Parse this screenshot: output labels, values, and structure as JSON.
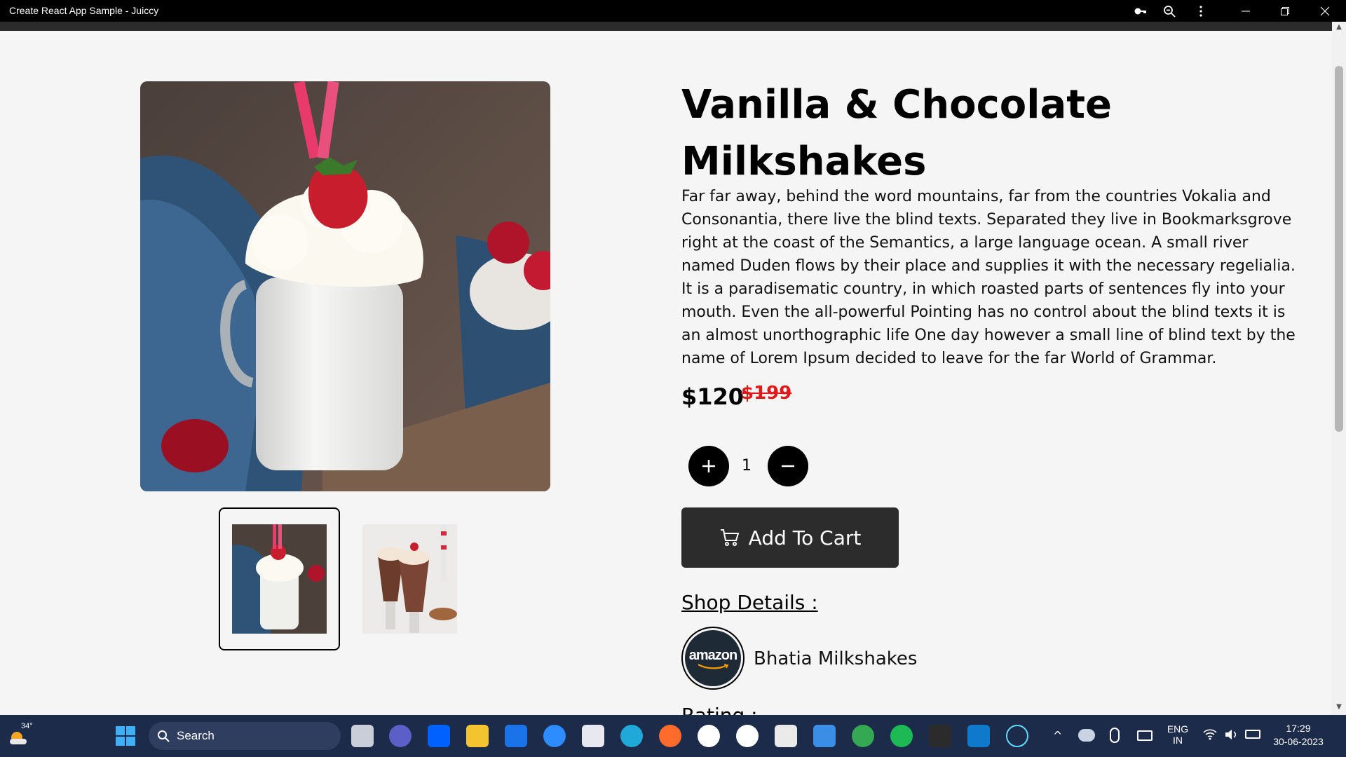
{
  "window": {
    "title": "Create React App Sample - Juiccy"
  },
  "product": {
    "title_line1": "Vanilla & Chocolate",
    "title_line2": "Milkshakes",
    "description": "Far far away, behind the word mountains, far from the countries Vokalia and Consonantia, there live the blind texts. Separated they live in Bookmarksgrove right at the coast of the Semantics, a large language ocean. A small river named Duden flows by their place and supplies it with the necessary regelialia. It is a paradisematic country, in which roasted parts of sentences fly into your mouth. Even the all-powerful Pointing has no control about the blind texts it is an almost unorthographic life One day however a small line of blind text by the name of Lorem Ipsum decided to leave for the far World of Grammar.",
    "price": "$120",
    "old_price": "$199",
    "quantity": "1",
    "add_to_cart": "Add To Cart",
    "shop_heading": "Shop Details :",
    "shop_logo_text": "amazon",
    "shop_name": "Bhatia Milkshakes",
    "rating_heading": "Rating :"
  },
  "taskbar": {
    "weather": "34°",
    "search_placeholder": "Search",
    "lang_line1": "ENG",
    "lang_line2": "IN",
    "time": "17:29",
    "date": "30-06-2023"
  },
  "colors": {
    "accent": "#000000",
    "old_price": "#e01818",
    "cart_button": "#2c2c2c",
    "taskbar": "#1c2b4a"
  }
}
